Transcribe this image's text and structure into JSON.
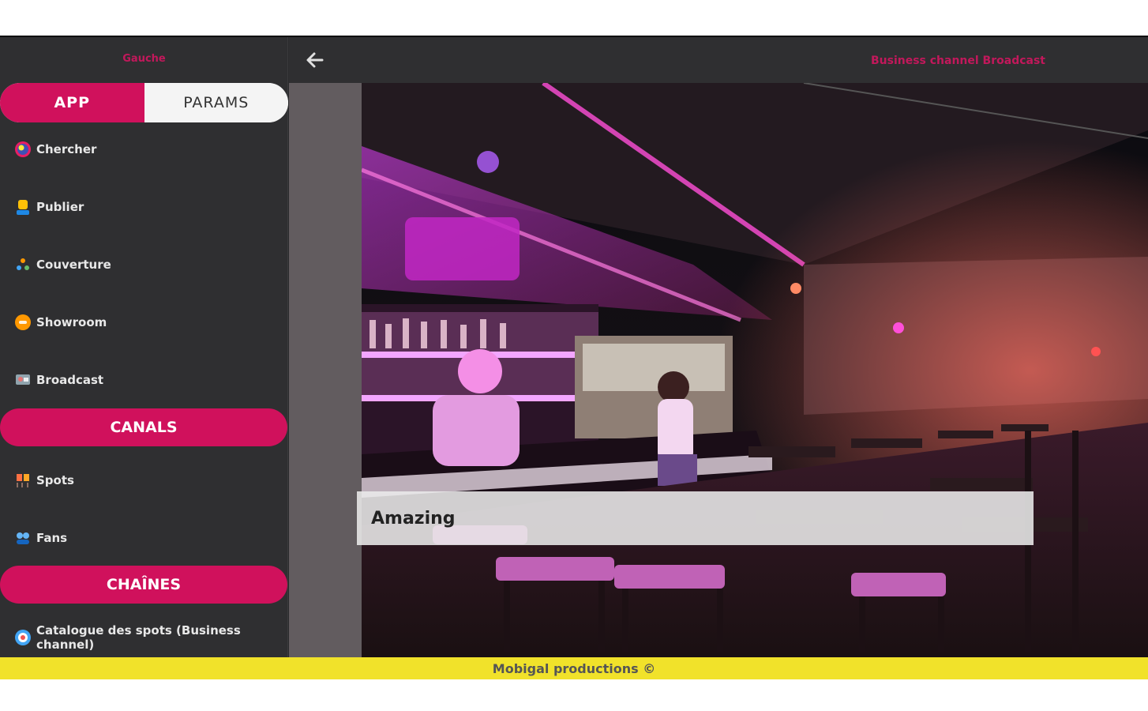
{
  "sidebar": {
    "title": "Gauche",
    "tabs": [
      {
        "label": "APP",
        "active": true
      },
      {
        "label": "PARAMS",
        "active": false
      }
    ],
    "app_items": [
      {
        "label": "Chercher",
        "icon": "search-globe-icon"
      },
      {
        "label": "Publier",
        "icon": "publisher-icon"
      },
      {
        "label": "Couverture",
        "icon": "coverage-icon"
      },
      {
        "label": "Showroom",
        "icon": "showroom-icon"
      },
      {
        "label": "Broadcast",
        "icon": "broadcast-icon"
      }
    ],
    "canals_label": "CANALS",
    "canals_items": [
      {
        "label": "Spots",
        "icon": "spots-icon"
      },
      {
        "label": "Fans",
        "icon": "fans-icon"
      }
    ],
    "chaines_label": "CHAÎNES",
    "chaines_items": [
      {
        "label": "Catalogue des spots (Business channel)",
        "icon": "catalogue-icon"
      }
    ]
  },
  "header": {
    "title": "Business channel Broadcast",
    "back_icon": "arrow-left-icon"
  },
  "main": {
    "caption": "Amazing"
  },
  "footer": {
    "text": "Mobigal productions ©"
  },
  "colors": {
    "accent": "#d0115c",
    "sidebar_bg": "#2f2f31",
    "footer_bg": "#f1e22a"
  }
}
